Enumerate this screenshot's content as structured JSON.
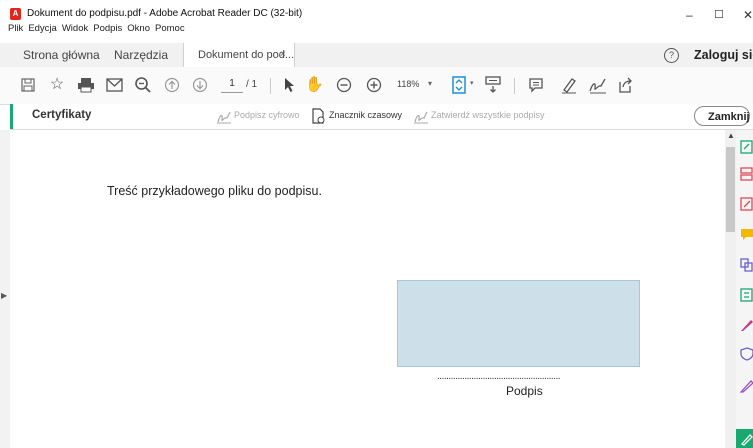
{
  "window": {
    "title": "Dokument do podpisu.pdf - Adobe Acrobat Reader DC (32-bit)",
    "app_icon_glyph": "A",
    "controls": {
      "minimize": "–",
      "maximize": "☐",
      "close": "✕"
    }
  },
  "menu": [
    "Plik",
    "Edycja",
    "Widok",
    "Podpis",
    "Okno",
    "Pomoc"
  ],
  "tabs": {
    "home": "Strona główna",
    "tools": "Narzędzia",
    "document": "Dokument do pod...",
    "close": "×"
  },
  "account": {
    "help": "?",
    "login": "Zaloguj się"
  },
  "toolbar": {
    "page_current": "1",
    "page_total": "/ 1",
    "zoom": "118%",
    "icons": [
      "save-icon",
      "bookmark-star-icon",
      "print-icon",
      "email-icon",
      "zoom-search-icon",
      "page-up-icon",
      "page-down-icon",
      "select-pointer-icon",
      "hand-icon",
      "zoom-out-icon",
      "zoom-in-icon",
      "zoom-dropdown-icon",
      "fit-page-icon",
      "scroll-mode-icon",
      "comment-icon",
      "highlight-pen-icon",
      "sign-icon",
      "share-icon"
    ]
  },
  "certificates": {
    "title": "Certyfikaty",
    "digital_sign": "Podpisz cyfrowo",
    "timestamp": "Znacznik czasowy",
    "validate_all": "Zatwierdź wszystkie podpisy",
    "close": "Zamknij"
  },
  "document": {
    "body_text": "Treść przykładowego pliku do podpisu.",
    "signature_line": "......................................................",
    "signature_label": "Podpis"
  },
  "colors": {
    "accent_green": "#1aa876",
    "signature_field": "#cde0ea",
    "acrobat_red": "#e3241b"
  },
  "right_panel_icons": [
    "export-pdf-icon",
    "organize-pages-icon",
    "edit-pdf-icon",
    "comment-tool-icon",
    "combine-files-icon",
    "convert-icon",
    "fill-sign-icon",
    "protect-icon",
    "sign-tool-icon",
    "certificates-tool-icon"
  ]
}
